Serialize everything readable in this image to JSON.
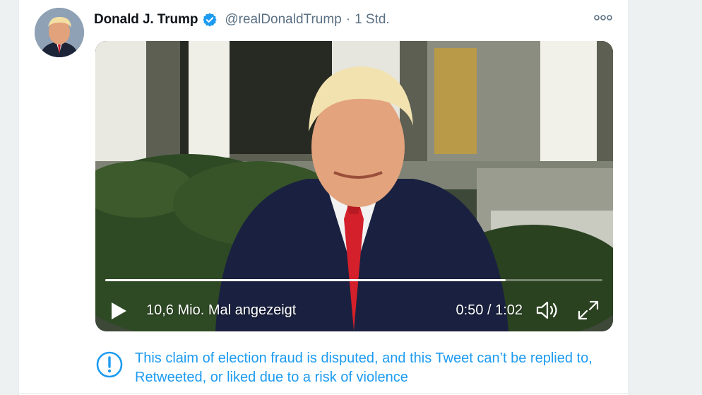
{
  "tweet": {
    "display_name": "Donald J. Trump",
    "handle": "@realDonaldTrump",
    "separator": "·",
    "timestamp": "1 Std.",
    "avatar_icon": "profile-photo",
    "verified_icon": "verified-badge-icon",
    "more_icon": "more-dots-icon"
  },
  "video": {
    "views": "10,6 Mio. Mal angezeigt",
    "time": "0:50 / 1:02",
    "progress": 0.806,
    "play_icon": "play-icon",
    "volume_icon": "volume-icon",
    "fullscreen_icon": "fullscreen-icon"
  },
  "notice": {
    "text": "This claim of election fraud is disputed, and this Tweet can’t be replied to, Retweeted, or liked due to a risk of violence",
    "icon": "exclamation-circle-icon"
  },
  "colors": {
    "accent": "#1d9bf0",
    "text_secondary": "#5b7083",
    "tie_red": "#d3202b"
  }
}
